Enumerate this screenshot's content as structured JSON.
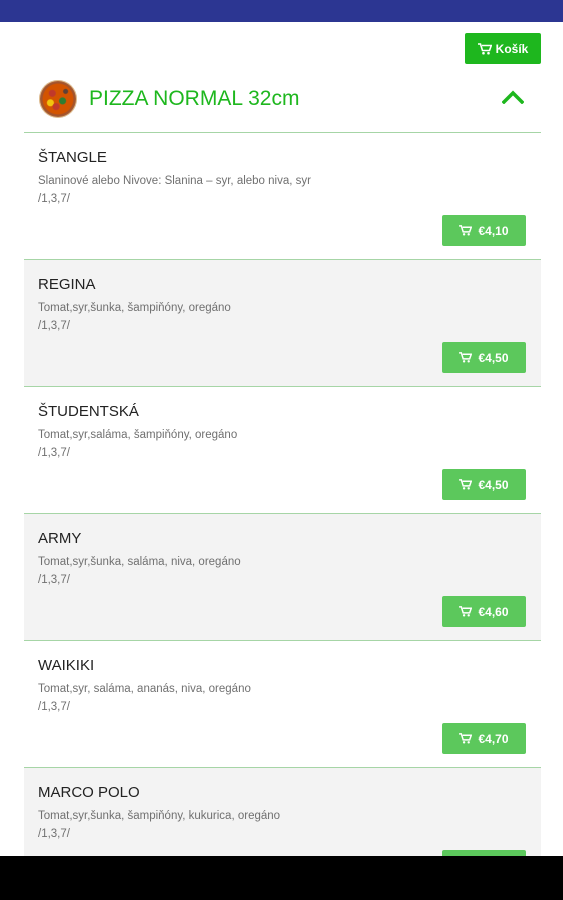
{
  "header": {
    "cart_label": "Košík"
  },
  "category": {
    "title": "PIZZA NORMAL 32cm"
  },
  "colors": {
    "status_bar": "#2c3692",
    "accent_green": "#1eb71e",
    "price_button_green": "#5cc85c",
    "divider_green": "#a6d5a6",
    "row_alt_bg": "#f3f3f3"
  },
  "icons": {
    "cart": "cart-icon",
    "collapse": "chevron-up-icon"
  },
  "items": [
    {
      "name": "ŠTANGLE",
      "description": "Slaninové alebo Nivove: Slanina – syr, alebo niva, syr",
      "allergens": "/1,3,7/",
      "price": "€4,10"
    },
    {
      "name": "REGINA",
      "description": "Tomat,syr,šunka, šampiňóny, oregáno",
      "allergens": "/1,3,7/",
      "price": "€4,50"
    },
    {
      "name": "ŠTUDENTSKÁ",
      "description": "Tomat,syr,saláma, šampiňóny, oregáno",
      "allergens": "/1,3,7/",
      "price": "€4,50"
    },
    {
      "name": "ARMY",
      "description": "Tomat,syr,šunka, saláma, niva, oregáno",
      "allergens": "/1,3,7/",
      "price": "€4,60"
    },
    {
      "name": "WAIKIKI",
      "description": "Tomat,syr, saláma, ananás, niva, oregáno",
      "allergens": "/1,3,7/",
      "price": "€4,70"
    },
    {
      "name": "MARCO POLO",
      "description": "Tomat,syr,šunka, šampiňóny, kukurica, oregáno",
      "allergens": "/1,3,7/",
      "price": ""
    }
  ]
}
